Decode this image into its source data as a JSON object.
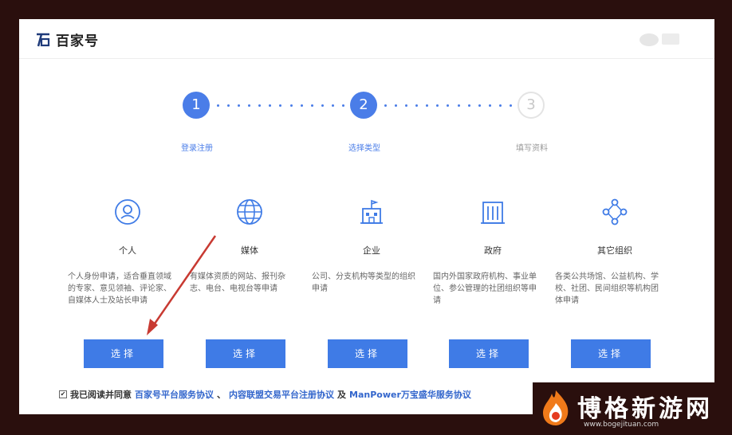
{
  "header": {
    "brand": "百家号"
  },
  "steps": [
    {
      "num": "1",
      "label": "登录注册",
      "state": "active"
    },
    {
      "num": "2",
      "label": "选择类型",
      "state": "active"
    },
    {
      "num": "3",
      "label": "填写资料",
      "state": "pending"
    }
  ],
  "cards": [
    {
      "title": "个人",
      "icon": "person-icon",
      "desc": "个人身份申请，适合垂直领域的专家、意见领袖、评论家、自媒体人士及站长申请",
      "button": "选择"
    },
    {
      "title": "媒体",
      "icon": "globe-icon",
      "desc": "有媒体资质的网站、报刊杂志、电台、电视台等申请",
      "button": "选择"
    },
    {
      "title": "企业",
      "icon": "building-icon",
      "desc": "公司、分支机构等类型的组织申请",
      "button": "选择"
    },
    {
      "title": "政府",
      "icon": "government-icon",
      "desc": "国内外国家政府机构、事业单位、参公管理的社团组织等申请",
      "button": "选择"
    },
    {
      "title": "其它组织",
      "icon": "network-icon",
      "desc": "各类公共场馆、公益机构、学校、社团、民间组织等机构团体申请",
      "button": "选择"
    }
  ],
  "agreement": {
    "check": "✔",
    "prefix": "我已阅读并同意",
    "link1": "百家号平台服务协议",
    "sep": "、",
    "link2": "内容联盟交易平台注册协议",
    "and": "及",
    "link3": "ManPower万宝盛华服务协议"
  },
  "watermark": {
    "title": "博格新游网",
    "url": "www.bogejituan.com"
  },
  "colors": {
    "accent": "#4a7de8",
    "button": "#3f7be6",
    "arrow": "#c83a32",
    "frame": "#2a0f0d"
  }
}
